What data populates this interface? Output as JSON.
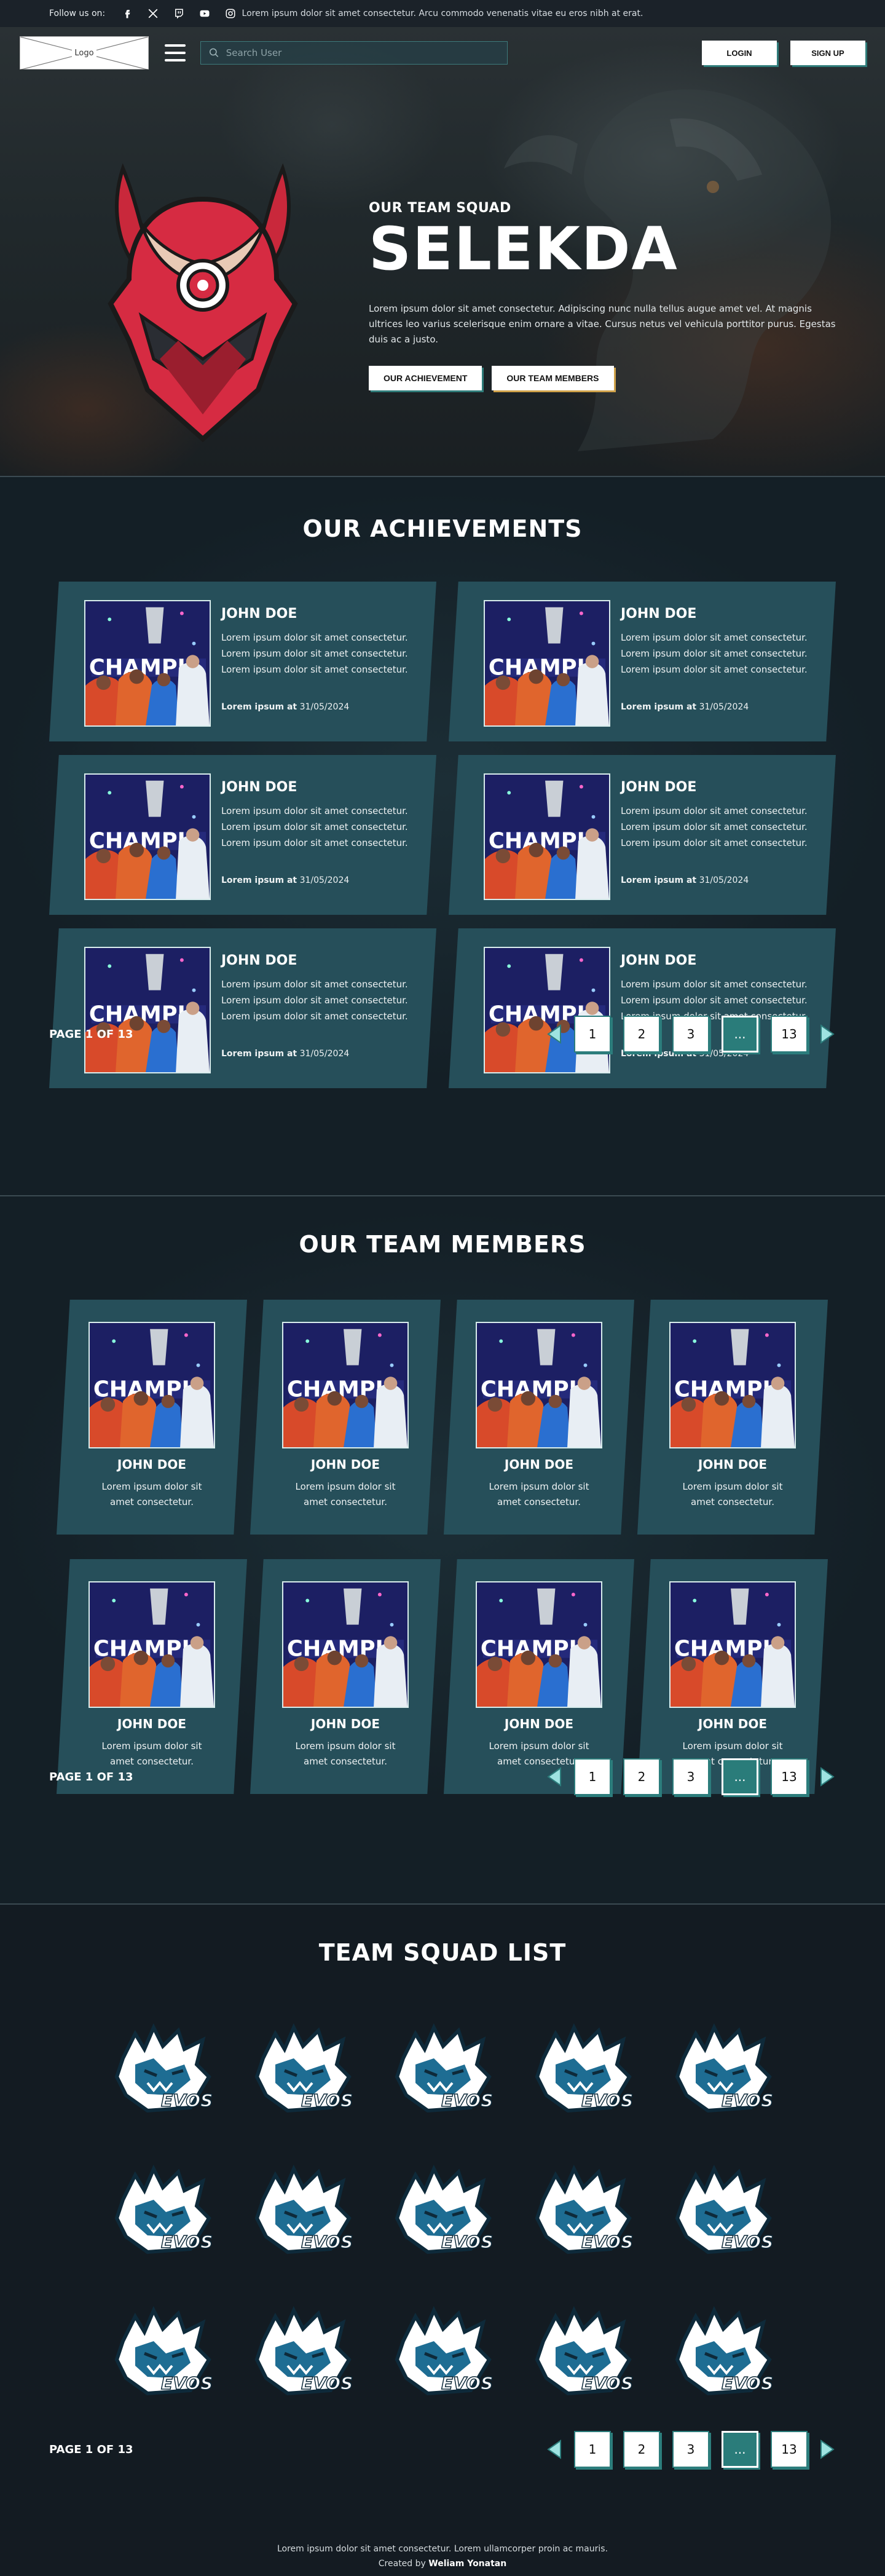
{
  "topbar": {
    "follow_label": "Follow us on:",
    "social_icons": [
      "facebook-icon",
      "x-icon",
      "twitch-icon",
      "youtube-icon",
      "instagram-icon"
    ],
    "message": "Lorem ipsum dolor sit amet consectetur. Arcu commodo venenatis vitae eu eros nibh at erat."
  },
  "header": {
    "logo_label": "Logo",
    "search_placeholder": "Search User",
    "login_label": "LOGIN",
    "signup_label": "SIGN UP"
  },
  "hero": {
    "subtitle": "OUR TEAM SQUAD",
    "title": "SELEKDA",
    "description": "Lorem ipsum dolor sit amet consectetur. Adipiscing nunc nulla tellus augue amet vel. At magnis ultrices leo varius scelerisque enim ornare a vitae. Cursus netus vel vehicula porttitor purus. Egestas duis ac a justo.",
    "btn_achievement": "OUR ACHIEVEMENT",
    "btn_members": "OUR TEAM MEMBERS"
  },
  "achievements": {
    "title": "OUR ACHIEVEMENTS",
    "items": [
      {
        "name": "JOHN DOE",
        "desc": "Lorem ipsum dolor sit amet consectetur. Lorem ipsum dolor sit amet consectetur. Lorem ipsum dolor sit amet consectetur.",
        "date_label": "Lorem ipsum at",
        "date": "31/05/2024"
      },
      {
        "name": "JOHN DOE",
        "desc": "Lorem ipsum dolor sit amet consectetur. Lorem ipsum dolor sit amet consectetur. Lorem ipsum dolor sit amet consectetur.",
        "date_label": "Lorem ipsum at",
        "date": "31/05/2024"
      },
      {
        "name": "JOHN DOE",
        "desc": "Lorem ipsum dolor sit amet consectetur. Lorem ipsum dolor sit amet consectetur. Lorem ipsum dolor sit amet consectetur.",
        "date_label": "Lorem ipsum at",
        "date": "31/05/2024"
      },
      {
        "name": "JOHN DOE",
        "desc": "Lorem ipsum dolor sit amet consectetur. Lorem ipsum dolor sit amet consectetur. Lorem ipsum dolor sit amet consectetur.",
        "date_label": "Lorem ipsum at",
        "date": "31/05/2024"
      },
      {
        "name": "JOHN DOE",
        "desc": "Lorem ipsum dolor sit amet consectetur. Lorem ipsum dolor sit amet consectetur. Lorem ipsum dolor sit amet consectetur.",
        "date_label": "Lorem ipsum at",
        "date": "31/05/2024"
      },
      {
        "name": "JOHN DOE",
        "desc": "Lorem ipsum dolor sit amet consectetur. Lorem ipsum dolor sit amet consectetur. Lorem ipsum dolor sit amet consectetur.",
        "date_label": "Lorem ipsum at",
        "date": "31/05/2024"
      }
    ],
    "pager": {
      "label": "PAGE 1 OF 13",
      "pages": [
        "1",
        "2",
        "3",
        "...",
        "13"
      ]
    }
  },
  "members": {
    "title": "OUR TEAM MEMBERS",
    "items": [
      {
        "name": "JOHN DOE",
        "desc": "Lorem ipsum dolor sit amet consectetur."
      },
      {
        "name": "JOHN DOE",
        "desc": "Lorem ipsum dolor sit amet consectetur."
      },
      {
        "name": "JOHN DOE",
        "desc": "Lorem ipsum dolor sit amet consectetur."
      },
      {
        "name": "JOHN DOE",
        "desc": "Lorem ipsum dolor sit amet consectetur."
      },
      {
        "name": "JOHN DOE",
        "desc": "Lorem ipsum dolor sit amet consectetur."
      },
      {
        "name": "JOHN DOE",
        "desc": "Lorem ipsum dolor sit amet consectetur."
      },
      {
        "name": "JOHN DOE",
        "desc": "Lorem ipsum dolor sit amet consectetur."
      },
      {
        "name": "JOHN DOE",
        "desc": "Lorem ipsum dolor sit amet consectetur."
      }
    ],
    "pager": {
      "label": "PAGE 1 OF 13",
      "pages": [
        "1",
        "2",
        "3",
        "...",
        "13"
      ]
    }
  },
  "squad": {
    "title": "TEAM SQUAD LIST",
    "logo_text": "EVOS",
    "logo_count": 15,
    "pager": {
      "label": "PAGE 1 OF 13",
      "pages": [
        "1",
        "2",
        "3",
        "...",
        "13"
      ]
    }
  },
  "photo_text": "CHAMPI",
  "footer": {
    "line1": "Lorem ipsum dolor sit amet consectetur. Lorem ullamcorper proin ac mauris.",
    "created_prefix": "Created by",
    "author": "Weliam Yonatan"
  },
  "colors": {
    "accent": "#2c7d7c",
    "card": "#264f5a",
    "highlight": "#d0a24a"
  }
}
